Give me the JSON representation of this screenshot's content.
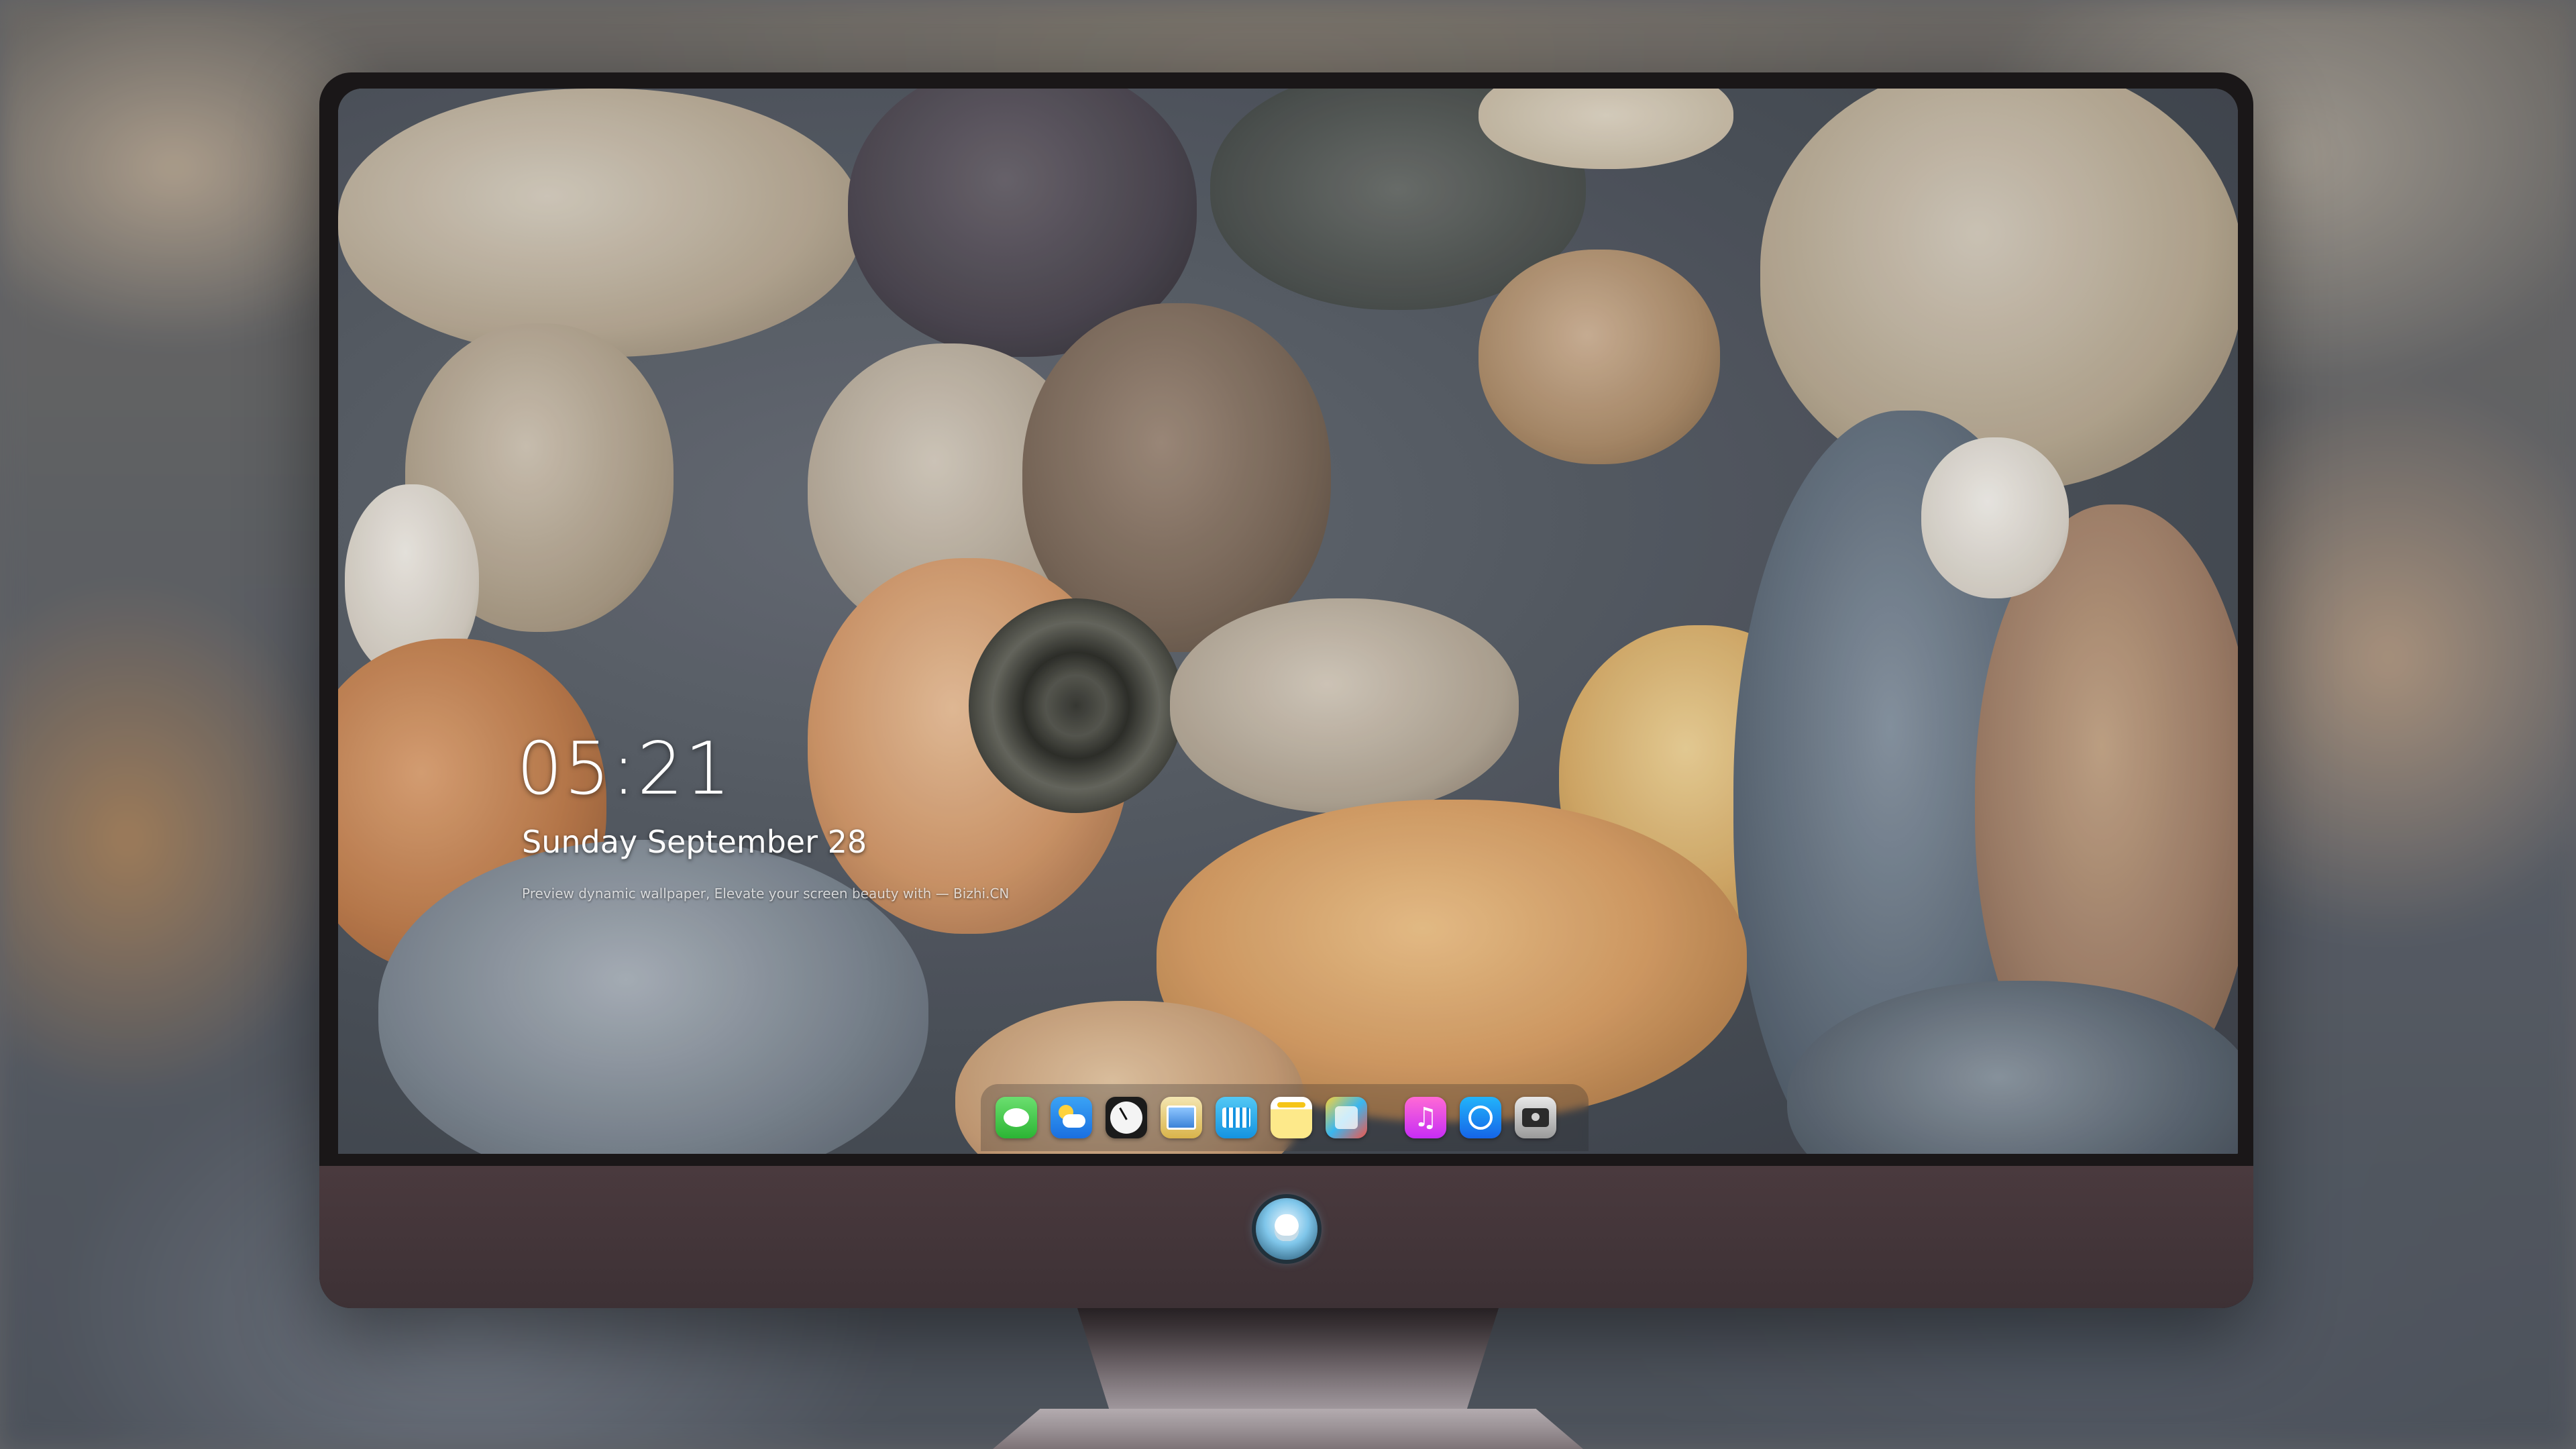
{
  "lock_screen": {
    "time": "05:21",
    "date": "Sunday September  28",
    "caption": "Preview dynamic wallpaper, Elevate your screen beauty with — Bizhi.CN"
  },
  "dock": {
    "items": [
      {
        "name": "messages-icon",
        "label": "Messages"
      },
      {
        "name": "weather-icon",
        "label": "Weather"
      },
      {
        "name": "clock-icon",
        "label": "Clock"
      },
      {
        "name": "preview-icon",
        "label": "Preview"
      },
      {
        "name": "clips-icon",
        "label": "Clips"
      },
      {
        "name": "notes-icon",
        "label": "Notes"
      },
      {
        "name": "photo-booth-icon",
        "label": "Photo Booth"
      },
      {
        "name": "music-icon",
        "label": "Music"
      },
      {
        "name": "app-store-icon",
        "label": "App Store"
      },
      {
        "name": "camera-icon",
        "label": "Camera"
      }
    ]
  },
  "colors": {
    "bezel": "#1a1718",
    "chin": "#4a3a3e",
    "text": "#ffffff"
  }
}
